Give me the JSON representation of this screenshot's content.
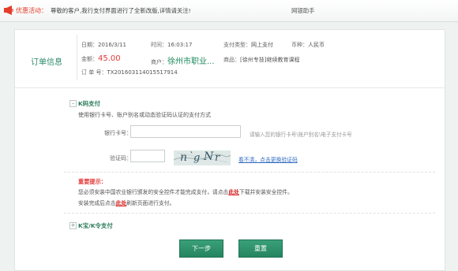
{
  "promo": {
    "label": "优惠活动：",
    "text": "尊敬的客户,我行支付界面进行了全新改版,详情请关注!",
    "assistant": "网银助手"
  },
  "order": {
    "title": "订单信息",
    "date_label": "日期：",
    "date": "2016/3/11",
    "time_label": "时间：",
    "time": "16:03:17",
    "pay_type_label": "支付类型：",
    "pay_type": "网上支付",
    "currency_label": "币种：",
    "currency": "人民币",
    "amount_label": "金额：",
    "amount": "45.00",
    "merchant_label": "商户：",
    "merchant": "徐州市职业...",
    "product_label": "商品：",
    "product": "[徐州专技]继续教育课程",
    "order_no_label": "订 单 号：",
    "order_no": "TX201603114015517914"
  },
  "kcard": {
    "toggle": "–",
    "title": "K码支付",
    "description": "使用银行卡号、账户别名或动态验证码认证的支付方式",
    "card_label": "银行卡号：",
    "card_value": "",
    "card_hint": "请输入您的银行卡号\\账户别名\\电子支付卡号",
    "captcha_label": "验证码：",
    "captcha_value": "",
    "captcha_text": "n`gNr",
    "refresh_link": "看不清，点击更换验证码"
  },
  "notice": {
    "title": "重要提示：",
    "line1_pre": "您必须安装中国农业银行颁发的安全控件才能完成支付，请点击",
    "line1_link": "此处",
    "line1_post": "下载并安装安全控件。",
    "line2_pre": "安装完成后点击",
    "line2_link": "此处",
    "line2_post": "刷新页面进行支付。"
  },
  "kbao": {
    "toggle": "+",
    "title": "K宝/K令支付"
  },
  "buttons": {
    "next": "下一步",
    "reset": "重置"
  },
  "colors": {
    "accent": "#2f8a6a",
    "amount": "#e23838",
    "link": "#2f6bbf"
  }
}
